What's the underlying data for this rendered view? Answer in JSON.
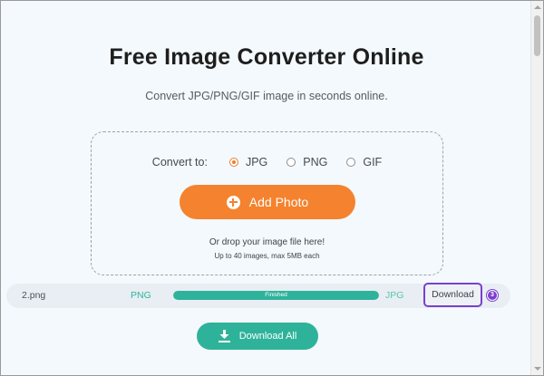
{
  "header": {
    "title": "Free Image Converter Online",
    "subtitle": "Convert JPG/PNG/GIF image in seconds online."
  },
  "converter": {
    "convert_label": "Convert to:",
    "formats": [
      {
        "label": "JPG",
        "selected": true
      },
      {
        "label": "PNG",
        "selected": false
      },
      {
        "label": "GIF",
        "selected": false
      }
    ],
    "add_photo_label": "Add Photo",
    "drop_hint": "Or drop your image file here!",
    "drop_limit": "Up to 40 images, max 5MB each"
  },
  "file_list": [
    {
      "name": "2.png",
      "from_format": "PNG",
      "status": "Finished",
      "progress": 1.0,
      "to_format": "JPG",
      "download_label": "Download",
      "step_badge": "3"
    }
  ],
  "download_all_label": "Download All",
  "colors": {
    "accent_orange": "#f5822e",
    "accent_teal": "#2eb39a",
    "highlight_purple": "#7c3fcf"
  },
  "icons": {
    "add_photo": "plus-circle-icon",
    "download_all": "download-icon"
  }
}
